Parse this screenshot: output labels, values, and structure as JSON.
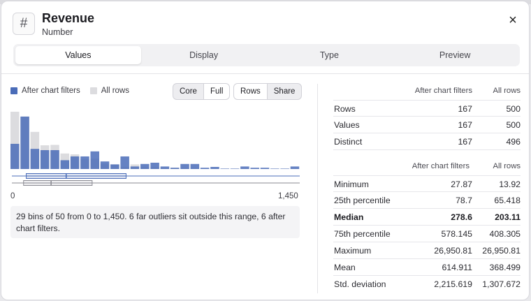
{
  "header": {
    "icon": "hash-icon",
    "icon_glyph": "#",
    "title": "Revenue",
    "subtitle": "Number",
    "close_glyph": "×"
  },
  "tabs": [
    {
      "label": "Values",
      "active": true
    },
    {
      "label": "Display",
      "active": false
    },
    {
      "label": "Type",
      "active": false
    },
    {
      "label": "Preview",
      "active": false
    }
  ],
  "legend": {
    "filtered_label": "After chart filters",
    "all_label": "All rows",
    "filtered_color": "#4a6cb8",
    "all_color": "#dcdcdf"
  },
  "scope_buttons": [
    {
      "label": "Core",
      "selected": true
    },
    {
      "label": "Full",
      "selected": false
    }
  ],
  "view_buttons": [
    {
      "label": "Rows",
      "selected": false
    },
    {
      "label": "Share",
      "selected": true
    }
  ],
  "histogram": {
    "x_min_label": "0",
    "x_max_label": "1,450",
    "note": "29 bins of 50 from 0 to 1,450. 6 far outliers sit outside this range, 6 after chart filters."
  },
  "chart_data": {
    "type": "bar",
    "x_range": [
      0,
      1450
    ],
    "bin_width": 50,
    "series": [
      {
        "name": "All rows",
        "values": [
          27.3,
          25.0,
          17.7,
          11.3,
          11.5,
          7.4,
          7.0,
          4.6,
          5.0,
          2.4,
          2.2,
          1.0,
          2.2,
          1.0,
          1.0,
          0.6,
          0.6,
          0.6,
          0.6,
          0.2,
          0.2,
          0.2,
          0.2,
          0.2,
          0.2,
          0.2,
          0.2,
          0.2,
          0.2
        ]
      },
      {
        "name": "After chart filters",
        "values": [
          12.0,
          25.0,
          9.6,
          9.0,
          9.0,
          4.2,
          6.0,
          6.0,
          8.4,
          3.6,
          2.2,
          6.0,
          1.2,
          2.4,
          3.0,
          1.2,
          0.6,
          2.4,
          2.4,
          0.6,
          1.0,
          0.2,
          0.2,
          1.2,
          0.6,
          0.6,
          0.2,
          0.2,
          1.2
        ]
      }
    ],
    "boxplots": [
      {
        "name": "After chart filters",
        "q1": 78.7,
        "median": 278.6,
        "q3": 578.145
      },
      {
        "name": "All rows",
        "q1": 65.418,
        "median": 203.11,
        "q3": 408.305
      }
    ]
  },
  "counts_table": {
    "headers": [
      "After chart filters",
      "All rows"
    ],
    "rows": [
      {
        "label": "Rows",
        "filtered": "167",
        "all": "500"
      },
      {
        "label": "Values",
        "filtered": "167",
        "all": "500"
      },
      {
        "label": "Distinct",
        "filtered": "167",
        "all": "496"
      }
    ]
  },
  "stats_table": {
    "headers": [
      "After chart filters",
      "All rows"
    ],
    "rows": [
      {
        "label": "Minimum",
        "filtered": "27.87",
        "all": "13.92",
        "bold": false
      },
      {
        "label": "25th percentile",
        "filtered": "78.7",
        "all": "65.418",
        "bold": false
      },
      {
        "label": "Median",
        "filtered": "278.6",
        "all": "203.11",
        "bold": true
      },
      {
        "label": "75th percentile",
        "filtered": "578.145",
        "all": "408.305",
        "bold": false
      },
      {
        "label": "Maximum",
        "filtered": "26,950.81",
        "all": "26,950.81",
        "bold": false
      },
      {
        "label": "Mean",
        "filtered": "614.911",
        "all": "368.499",
        "bold": false
      },
      {
        "label": "Std. deviation",
        "filtered": "2,215.619",
        "all": "1,307.672",
        "bold": false
      }
    ]
  }
}
